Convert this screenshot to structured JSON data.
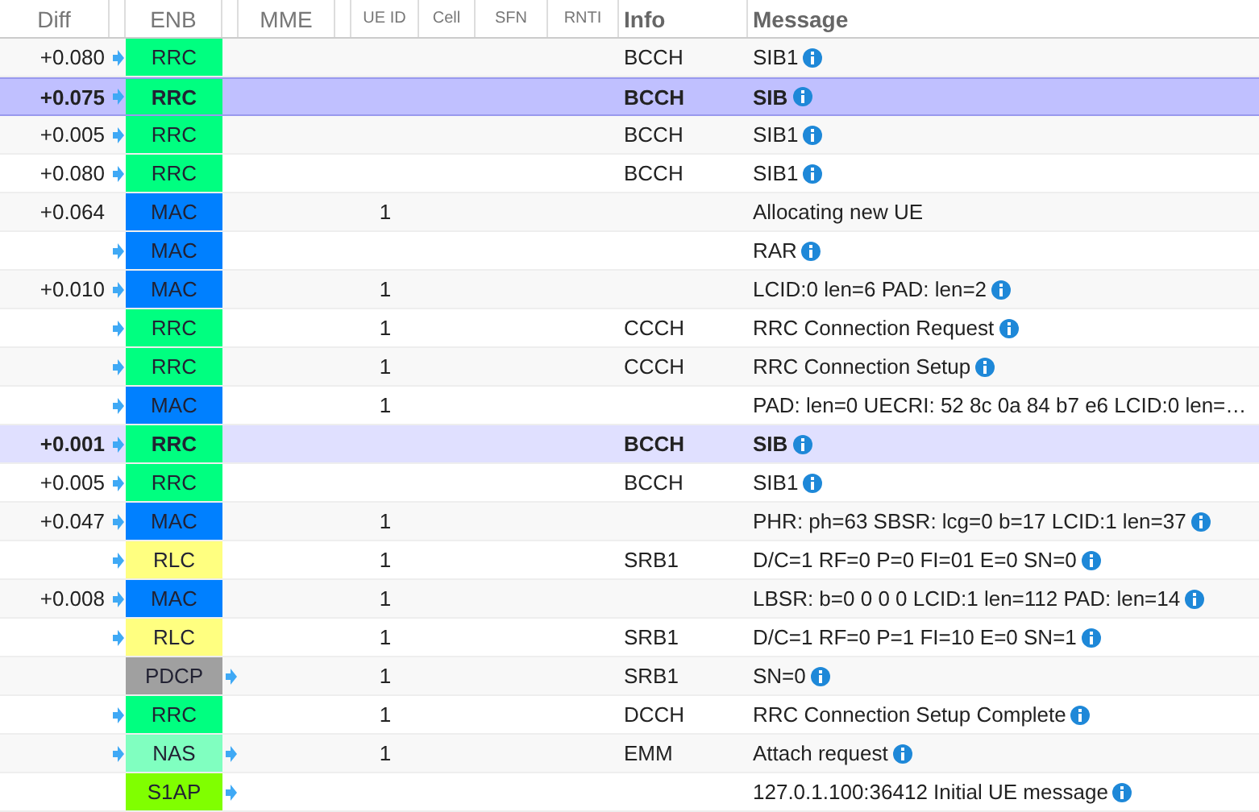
{
  "columns": [
    {
      "label": "Diff"
    },
    {
      "label": "ENB"
    },
    {
      "label": "MME"
    },
    {
      "label": "UE ID"
    },
    {
      "label": "Cell"
    },
    {
      "label": "SFN"
    },
    {
      "label": "RNTI"
    },
    {
      "label": "Info"
    },
    {
      "label": "Message"
    }
  ],
  "rows": [
    {
      "diff": "+0.080",
      "diff_arrow": true,
      "layer": "RRC",
      "color": "#00ff80",
      "mme_arrow": false,
      "info": "BCCH",
      "message": "SIB1",
      "info_icon": true,
      "selected": false,
      "related": false
    },
    {
      "diff": "+0.075",
      "diff_arrow": true,
      "layer": "RRC",
      "color": "#00ff80",
      "mme_arrow": false,
      "info": "BCCH",
      "message": "SIB",
      "info_icon": true,
      "selected": true,
      "related": false
    },
    {
      "diff": "+0.005",
      "diff_arrow": true,
      "layer": "RRC",
      "color": "#00ff80",
      "mme_arrow": false,
      "info": "BCCH",
      "message": "SIB1",
      "info_icon": true,
      "selected": false,
      "related": false
    },
    {
      "diff": "+0.080",
      "diff_arrow": true,
      "layer": "RRC",
      "color": "#00ff80",
      "mme_arrow": false,
      "info": "BCCH",
      "message": "SIB1",
      "info_icon": true,
      "selected": false,
      "related": false
    },
    {
      "diff": "+0.064",
      "diff_arrow": false,
      "layer": "MAC",
      "color": "#0080ff",
      "mme_arrow": false,
      "ue_id": "1",
      "message": "Allocating new UE",
      "info_icon": false,
      "selected": false,
      "related": false
    },
    {
      "diff_arrow": true,
      "layer": "MAC",
      "color": "#0080ff",
      "mme_arrow": false,
      "message": "RAR",
      "info_icon": true,
      "selected": false,
      "related": false
    },
    {
      "diff": "+0.010",
      "diff_arrow": true,
      "layer": "MAC",
      "color": "#0080ff",
      "mme_arrow": false,
      "ue_id": "1",
      "message": "LCID:0 len=6 PAD: len=2",
      "info_icon": true,
      "selected": false,
      "related": false
    },
    {
      "diff_arrow": true,
      "layer": "RRC",
      "color": "#00ff80",
      "mme_arrow": false,
      "ue_id": "1",
      "info": "CCCH",
      "message": "RRC Connection Request",
      "info_icon": true,
      "selected": false,
      "related": false
    },
    {
      "diff_arrow": true,
      "layer": "RRC",
      "color": "#00ff80",
      "mme_arrow": false,
      "ue_id": "1",
      "info": "CCCH",
      "message": "RRC Connection Setup",
      "info_icon": true,
      "selected": false,
      "related": false
    },
    {
      "diff_arrow": true,
      "layer": "MAC",
      "color": "#0080ff",
      "mme_arrow": false,
      "ue_id": "1",
      "message": "PAD: len=0 UECRI: 52 8c 0a 84 b7 e6 LCID:0 len=…",
      "info_icon": false,
      "selected": false,
      "related": false
    },
    {
      "diff": "+0.001",
      "diff_arrow": true,
      "layer": "RRC",
      "color": "#00ff80",
      "mme_arrow": false,
      "info": "BCCH",
      "message": "SIB",
      "info_icon": true,
      "selected": false,
      "related": true
    },
    {
      "diff": "+0.005",
      "diff_arrow": true,
      "layer": "RRC",
      "color": "#00ff80",
      "mme_arrow": false,
      "info": "BCCH",
      "message": "SIB1",
      "info_icon": true,
      "selected": false,
      "related": false
    },
    {
      "diff": "+0.047",
      "diff_arrow": true,
      "layer": "MAC",
      "color": "#0080ff",
      "mme_arrow": false,
      "ue_id": "1",
      "message": "PHR: ph=63 SBSR: lcg=0 b=17 LCID:1 len=37",
      "info_icon": true,
      "selected": false,
      "related": false
    },
    {
      "diff_arrow": true,
      "layer": "RLC",
      "color": "#ffff80",
      "mme_arrow": false,
      "ue_id": "1",
      "info": "SRB1",
      "message": "D/C=1 RF=0 P=0 FI=01 E=0 SN=0",
      "info_icon": true,
      "selected": false,
      "related": false
    },
    {
      "diff": "+0.008",
      "diff_arrow": true,
      "layer": "MAC",
      "color": "#0080ff",
      "mme_arrow": false,
      "ue_id": "1",
      "message": "LBSR: b=0 0 0 0 LCID:1 len=112 PAD: len=14",
      "info_icon": true,
      "selected": false,
      "related": false
    },
    {
      "diff_arrow": true,
      "layer": "RLC",
      "color": "#ffff80",
      "mme_arrow": false,
      "ue_id": "1",
      "info": "SRB1",
      "message": "D/C=1 RF=0 P=1 FI=10 E=0 SN=1",
      "info_icon": true,
      "selected": false,
      "related": false
    },
    {
      "diff_arrow": false,
      "layer": "PDCP",
      "color": "#a0a0a0",
      "mme_arrow": true,
      "ue_id": "1",
      "info": "SRB1",
      "message": "SN=0",
      "info_icon": true,
      "selected": false,
      "related": false
    },
    {
      "diff_arrow": true,
      "layer": "RRC",
      "color": "#00ff80",
      "mme_arrow": false,
      "ue_id": "1",
      "info": "DCCH",
      "message": "RRC Connection Setup Complete",
      "info_icon": true,
      "selected": false,
      "related": false
    },
    {
      "diff_arrow": true,
      "layer": "NAS",
      "color": "#80ffc0",
      "mme_arrow": true,
      "ue_id": "1",
      "info": "EMM",
      "message": "Attach request",
      "info_icon": true,
      "selected": false,
      "related": false
    },
    {
      "diff_arrow": false,
      "layer": "S1AP",
      "color": "#80ff00",
      "mme_arrow": true,
      "message": "127.0.1.100:36412 Initial UE message",
      "info_icon": true,
      "selected": false,
      "related": false
    }
  ]
}
